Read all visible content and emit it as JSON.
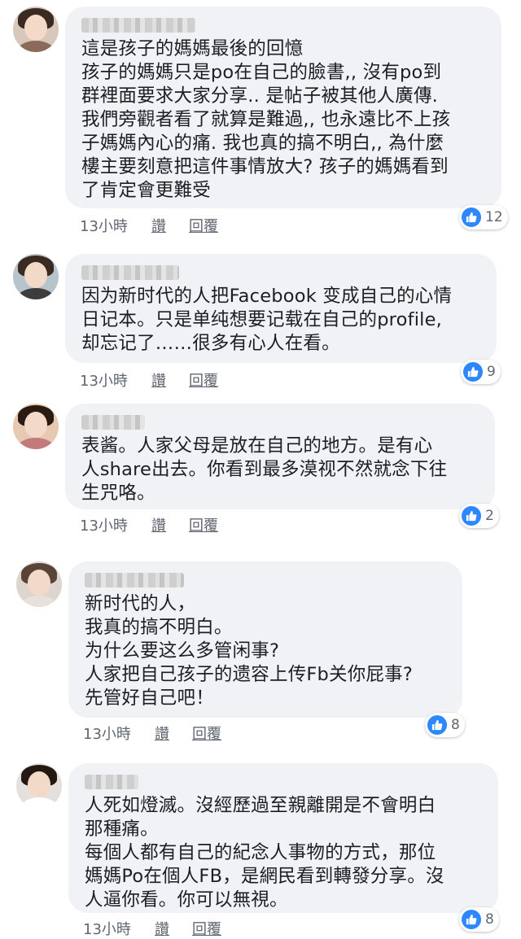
{
  "comments": [
    {
      "author": "",
      "text": "這是孩子的媽媽最後的回憶\n孩子的媽媽只是po在自己的臉書,, 沒有po到\n群裡面要求大家分享.. 是帖子被其他人廣傳.\n我們旁觀者看了就算是難過,, 也永遠比不上孩\n子媽媽內心的痛. 我也真的搞不明白,, 為什麼\n樓主要刻意把這件事情放大? 孩子的媽媽看到\n了肯定會更難受",
      "time": "13小時",
      "like_label": "讚",
      "reply_label": "回覆",
      "reactions": "12"
    },
    {
      "author": "",
      "text": "因为新时代的人把Facebook 变成自己的心情\n日记本。只是单纯想要记载在自己的profile,\n却忘记了……很多有心人在看。",
      "time": "13小時",
      "like_label": "讚",
      "reply_label": "回覆",
      "reactions": "9"
    },
    {
      "author": "",
      "text": "表酱。人家父母是放在自己的地方。是有心\n人share出去。你看到最多漠视不然就念下往\n生咒咯。",
      "time": "13小時",
      "like_label": "讚",
      "reply_label": "回覆",
      "reactions": "2"
    },
    {
      "author": "",
      "text": "新时代的人，\n我真的搞不明白。\n为什么要这么多管闲事?\n人家把自己孩子的遗容上传Fb关你屁事?\n先管好自己吧！",
      "time": "13小時",
      "like_label": "讚",
      "reply_label": "回覆",
      "reactions": "8"
    },
    {
      "author": "",
      "text": "人死如燈滅。沒經歷過至親離開是不會明白\n那種痛。\n每個人都有自己的紀念人事物的方式，那位\n媽媽Po在個人FB，是網民看到轉發分享。沒\n人逼你看。你可以無視。",
      "time": "13小時",
      "like_label": "讚",
      "reply_label": "回覆",
      "reactions": "8"
    }
  ]
}
